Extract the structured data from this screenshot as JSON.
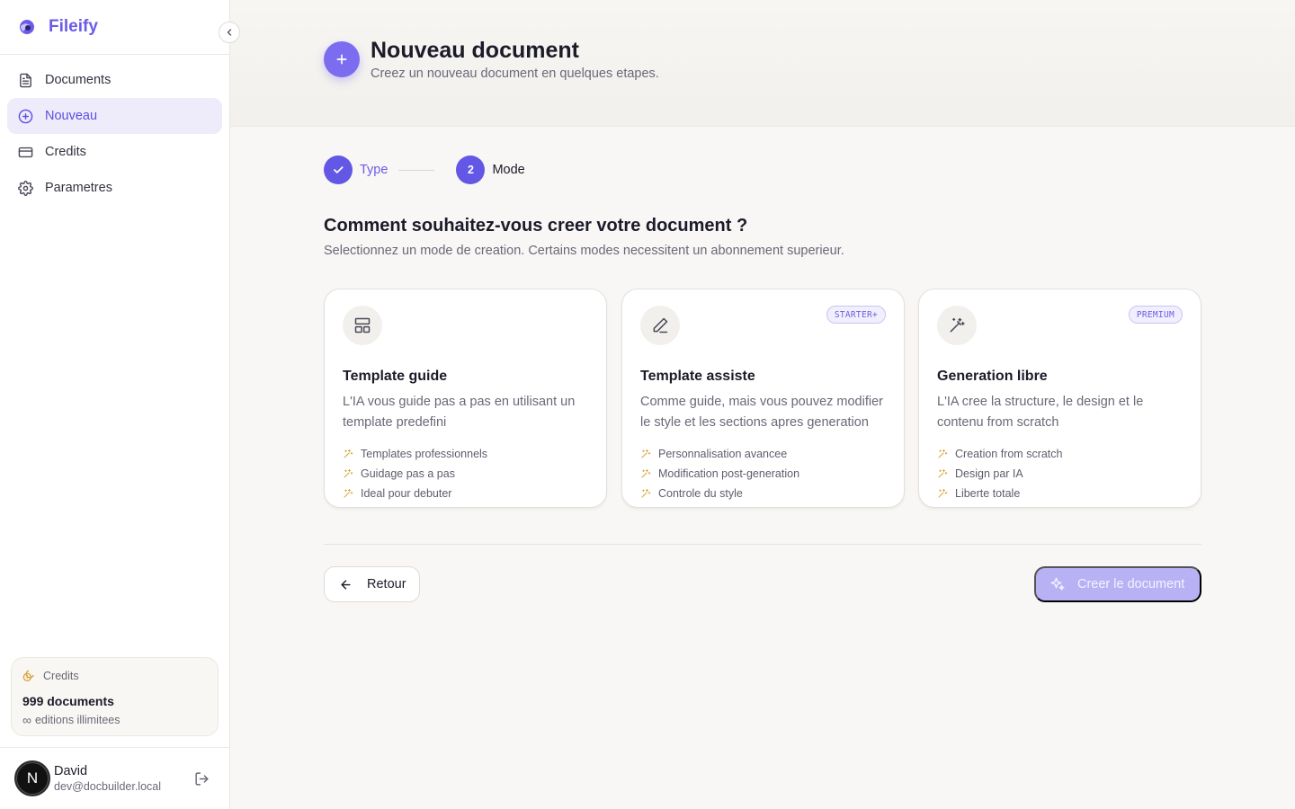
{
  "app": {
    "name": "Fileify"
  },
  "sidebar": {
    "items": [
      {
        "label": "Documents",
        "icon": "document-icon",
        "active": false
      },
      {
        "label": "Nouveau",
        "icon": "plus-circle-icon",
        "active": true
      },
      {
        "label": "Credits",
        "icon": "credit-card-icon",
        "active": false
      },
      {
        "label": "Parametres",
        "icon": "gear-icon",
        "active": false
      }
    ],
    "credits": {
      "label": "Credits",
      "count": "999 documents",
      "sub": "editions illimitees"
    },
    "user": {
      "initial": "N",
      "name": "David",
      "email": "dev@docbuilder.local"
    }
  },
  "header": {
    "title": "Nouveau document",
    "subtitle": "Creez un nouveau document en quelques etapes."
  },
  "stepper": {
    "steps": [
      {
        "label": "Type",
        "state": "done",
        "number": ""
      },
      {
        "label": "Mode",
        "state": "current",
        "number": "2"
      }
    ]
  },
  "question": {
    "title": "Comment souhaitez-vous creer votre document ?",
    "subtitle": "Selectionnez un mode de creation. Certains modes necessitent un abonnement superieur."
  },
  "modes": [
    {
      "title": "Template guide",
      "desc": "L'IA vous guide pas a pas en utilisant un template predefini",
      "badge": "",
      "icon": "layout-icon",
      "features": [
        "Templates professionnels",
        "Guidage pas a pas",
        "Ideal pour debuter"
      ]
    },
    {
      "title": "Template assiste",
      "desc": "Comme guide, mais vous pouvez modifier le style et les sections apres generation",
      "badge": "STARTER+",
      "icon": "pencil-icon",
      "features": [
        "Personnalisation avancee",
        "Modification post-generation",
        "Controle du style"
      ]
    },
    {
      "title": "Generation libre",
      "desc": "L'IA cree la structure, le design et le contenu from scratch",
      "badge": "PREMIUM",
      "icon": "magic-wand-icon",
      "features": [
        "Creation from scratch",
        "Design par IA",
        "Liberte totale"
      ]
    }
  ],
  "footer": {
    "back_label": "Retour",
    "create_label": "Creer le document"
  },
  "colors": {
    "accent": "#6b5ce7",
    "accent_disabled": "#b8b2f5",
    "sparkle": "#d9a43a"
  }
}
